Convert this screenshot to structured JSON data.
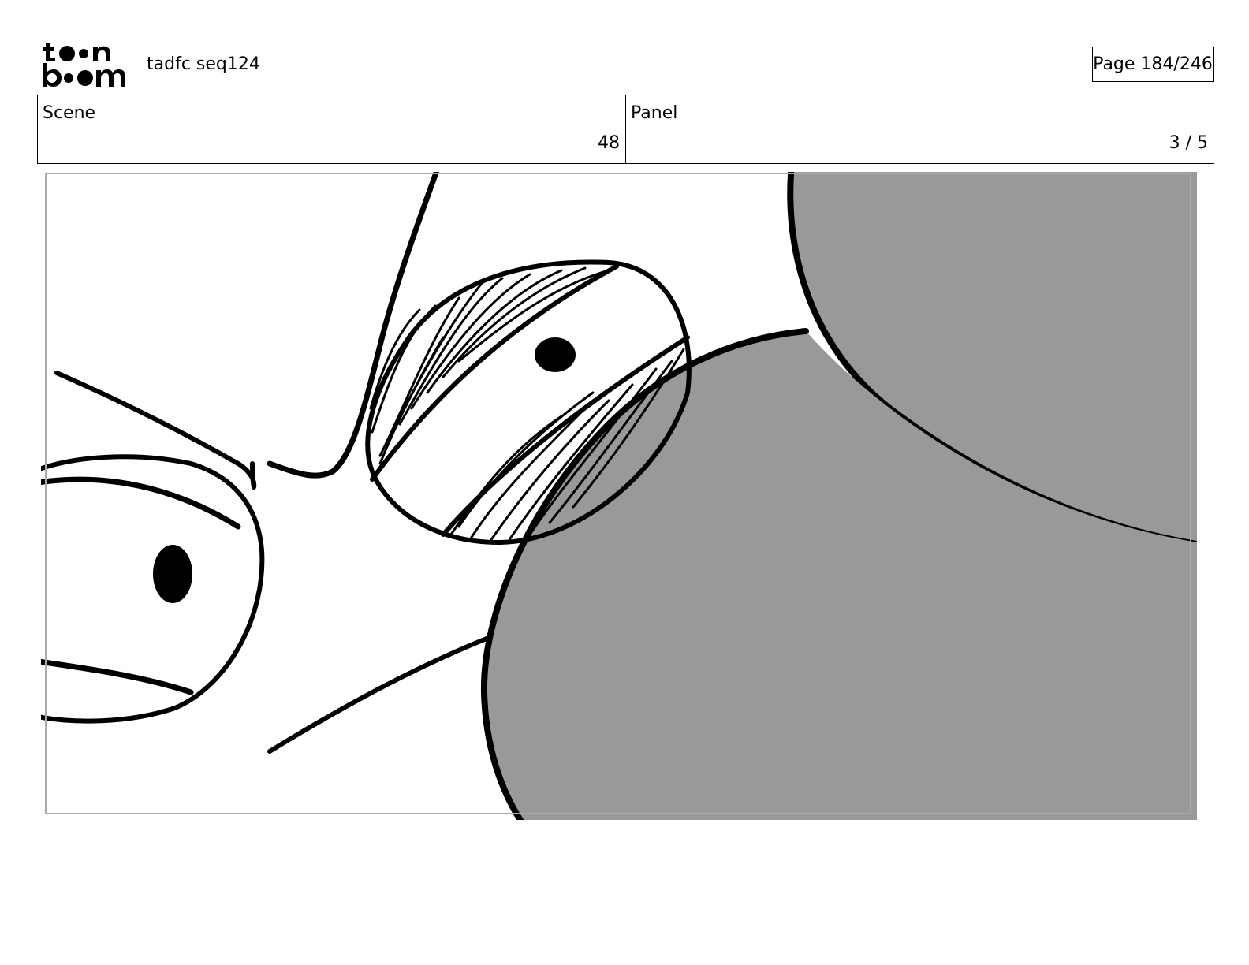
{
  "header": {
    "logo": {
      "line1": "toon",
      "line2": "boom",
      "icon": "toon-boom-logo"
    },
    "document_title": "tadfc seq124",
    "page_label": "Page 184/246"
  },
  "info": {
    "scene_label": "Scene",
    "scene_value": "48",
    "panel_label": "Panel",
    "panel_value": "3 / 5"
  },
  "panel_image": {
    "description_icon": "storyboard-drawing",
    "fill_color": "#999999",
    "line_color": "#000000"
  }
}
